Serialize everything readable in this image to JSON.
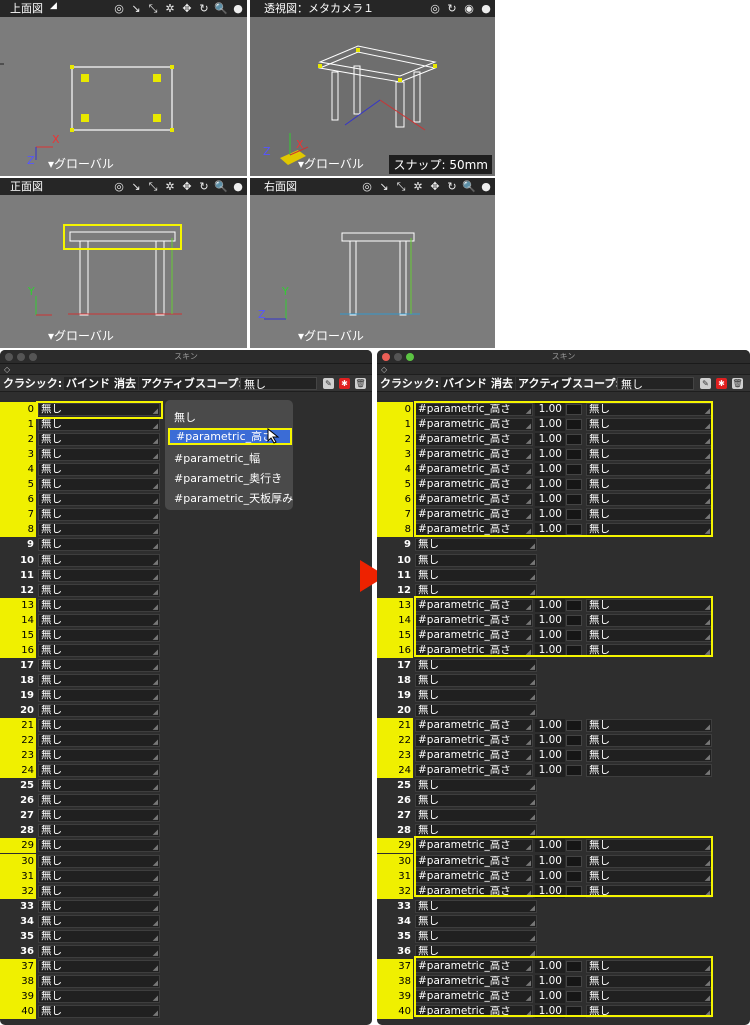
{
  "viewports": {
    "top": {
      "title": "上面図",
      "footer": "▾グローバル"
    },
    "persp": {
      "title": "透視図：メタカメラ１",
      "footer": "▾グローバル",
      "snap": "スナップ: 50mm"
    },
    "front": {
      "title": "正面図",
      "footer": "▾グローバル"
    },
    "right": {
      "title": "右面図",
      "footer": "▾グローバル"
    },
    "tools": [
      "◎",
      "↘",
      "⤡",
      "✲",
      "✥",
      "↻",
      "🔍",
      "●"
    ],
    "axis": {
      "x": "X",
      "y": "Y",
      "z": "Z"
    }
  },
  "panel_title": "スキン",
  "toolbar": {
    "mode": "クラシック:",
    "bind": "バインド",
    "delete": "消去",
    "active": "アクティブ",
    "scope_label": "スコープ:",
    "scope_value": "無し"
  },
  "none_label": "無し",
  "param_label": "#parametric_高さ",
  "value": "1.00",
  "left_rows": [
    "0",
    "1",
    "2",
    "3",
    "4",
    "5",
    "6",
    "7",
    "8",
    "9",
    "10",
    "11",
    "12",
    "13",
    "14",
    "15",
    "16",
    "17",
    "18",
    "19",
    "20",
    "21",
    "22",
    "23",
    "24",
    "25",
    "26",
    "27",
    "28",
    "29",
    "30",
    "31",
    "32",
    "33",
    "34",
    "35",
    "36",
    "37",
    "38",
    "39",
    "40"
  ],
  "highlighted_rows": [
    0,
    1,
    2,
    3,
    4,
    5,
    6,
    7,
    8,
    13,
    14,
    15,
    16,
    21,
    22,
    23,
    24,
    29,
    30,
    31,
    32,
    37,
    38,
    39,
    40
  ],
  "dropdown": {
    "items": [
      "無し",
      "#parametric_高さ",
      "#parametric_幅",
      "#parametric_奥行き",
      "#parametric_天板厚み"
    ],
    "selected": 1
  },
  "colors": {
    "highlight": "#f0f000",
    "selection": "#3b6cd6",
    "arrow": "#ee2200"
  }
}
